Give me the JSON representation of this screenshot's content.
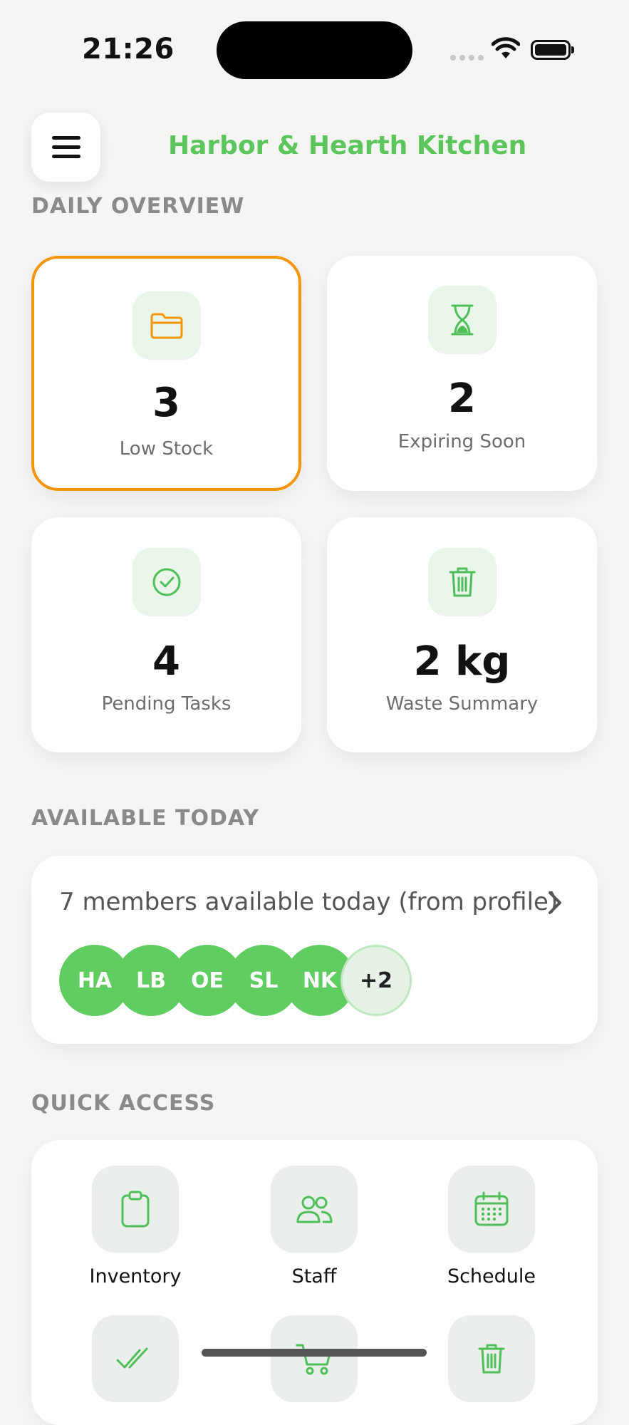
{
  "status_bar": {
    "time": "21:26"
  },
  "header": {
    "title": "Harbor & Hearth Kitchen",
    "menu_icon": "hamburger-menu-icon"
  },
  "daily_overview": {
    "label": "DAILY OVERVIEW",
    "cards": [
      {
        "value": "3",
        "label": "Low Stock",
        "icon": "folder-icon",
        "selected": true
      },
      {
        "value": "2",
        "label": "Expiring Soon",
        "icon": "hourglass-icon",
        "selected": false
      },
      {
        "value": "4",
        "label": "Pending Tasks",
        "icon": "check-circle-icon",
        "selected": false
      },
      {
        "value": "2 kg",
        "label": "Waste Summary",
        "icon": "trash-icon",
        "selected": false
      }
    ]
  },
  "available_today": {
    "label": "AVAILABLE TODAY",
    "summary": "7 members available today (from profile)",
    "avatars": [
      "HA",
      "LB",
      "OE",
      "SL",
      "NK"
    ],
    "more": "+2"
  },
  "quick_access": {
    "label": "QUICK ACCESS",
    "items": [
      {
        "label": "Inventory",
        "icon": "clipboard-icon"
      },
      {
        "label": "Staff",
        "icon": "people-icon"
      },
      {
        "label": "Schedule",
        "icon": "calendar-icon"
      },
      {
        "label": "",
        "icon": "double-check-icon"
      },
      {
        "label": "",
        "icon": "cart-icon"
      },
      {
        "label": "",
        "icon": "trash-icon"
      }
    ]
  },
  "colors": {
    "accent": "#5cc55c",
    "selected_border": "#f5960a",
    "background": "#f5f5f3"
  }
}
